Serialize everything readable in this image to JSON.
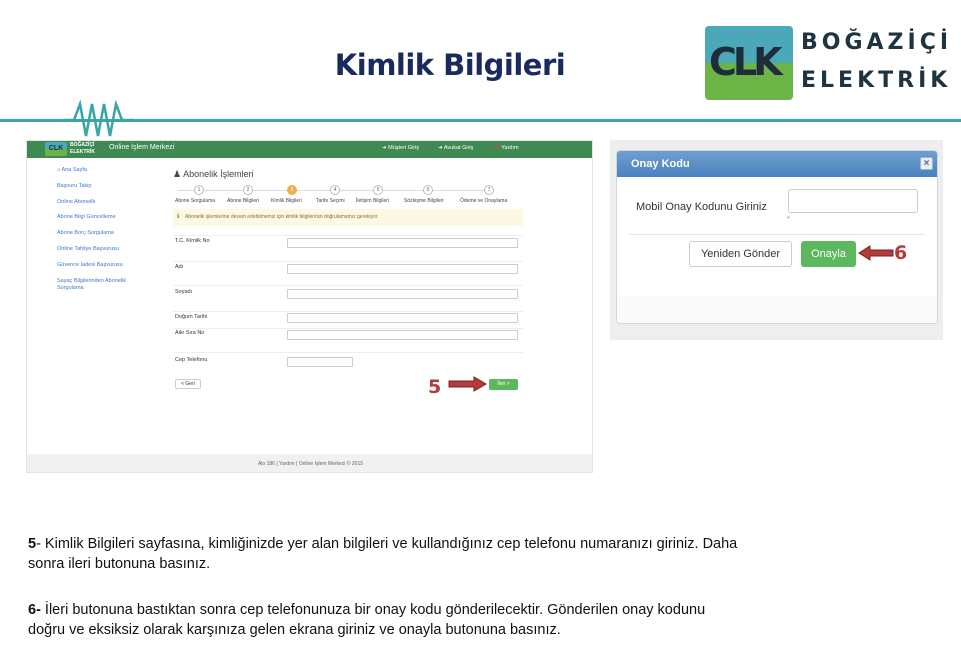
{
  "slide": {
    "title": "Kimlik Bilgileri",
    "logo": {
      "mark": "CLK",
      "line1": "BOĞAZİÇİ",
      "line2": "ELEKTRİK"
    }
  },
  "app": {
    "logo_word": "BOĞAZİÇİ ELEKTRİK",
    "title": "Online İşlem Merkezi",
    "nav": [
      "Müşteri Giriş",
      "Avukat Giriş",
      "Yardım"
    ],
    "sidebar": [
      "Ana Sayfa",
      "Başvuru Takip",
      "Online Abonelik",
      "Abone Bilgi Güncelleme",
      "Abone Borç Sorgulama",
      "Online Tahliye Başvurusu",
      "Güvence İadesi Başvurusu",
      "Sayaç Bilgilerinden Abonelik Sorgulama"
    ],
    "heading": "Abonelik İşlemleri",
    "steps": [
      {
        "n": "1",
        "label": "Abone Sorgulama"
      },
      {
        "n": "2",
        "label": "Abone Bilgileri"
      },
      {
        "n": "3",
        "label": "Kimlik Bilgileri"
      },
      {
        "n": "4",
        "label": "Tarife Seçimi"
      },
      {
        "n": "5",
        "label": "İletişim Bilgileri"
      },
      {
        "n": "6",
        "label": "Sözleşme Bilgileri"
      },
      {
        "n": "7",
        "label": "Ödeme ve Onaylama"
      }
    ],
    "alert": "Abonelik işlemlerine devam edebilmemiz için kimlik bilgilerinizi doğrulamamız gerekiyor.",
    "fields": [
      "T.C. Kimlik No",
      "Adı",
      "Soyadı",
      "Doğum Tarihi",
      "Aile Sıra No",
      "Cep Telefonu"
    ],
    "back_label": "< Geri",
    "next_label": "İleri >",
    "footer": "Alo 186 | Yardım | Online İşlem Merkezi © 2015"
  },
  "modal": {
    "title": "Onay Kodu",
    "close": "×",
    "label": "Mobil Onay Kodunu Giriniz",
    "required_mark": "*",
    "resend_label": "Yeniden Gönder",
    "approve_label": "Onayla"
  },
  "markers": {
    "step5": "5",
    "step6": "6"
  },
  "description": {
    "p1_num": "5",
    "p1_line1": "- Kimlik Bilgileri  sayfasına, kimliğinizde yer alan bilgileri ve kullandığınız cep telefonu numaranızı giriniz. Daha",
    "p1_line2": "sonra ileri butonuna basınız.",
    "p2_num": "6-",
    "p2_line1": " İleri butonuna bastıktan sonra cep telefonunuza bir onay kodu gönderilecektir. Gönderilen onay kodunu",
    "p2_line2": "doğru ve eksiksiz olarak karşınıza gelen ekrana giriniz ve onayla butonuna basınız."
  },
  "colors": {
    "title": "#1a2a5e",
    "teal_line": "#3aa5a5",
    "app_header": "#3f8a52",
    "success": "#5cb85c",
    "marker": "#b53a3a"
  }
}
